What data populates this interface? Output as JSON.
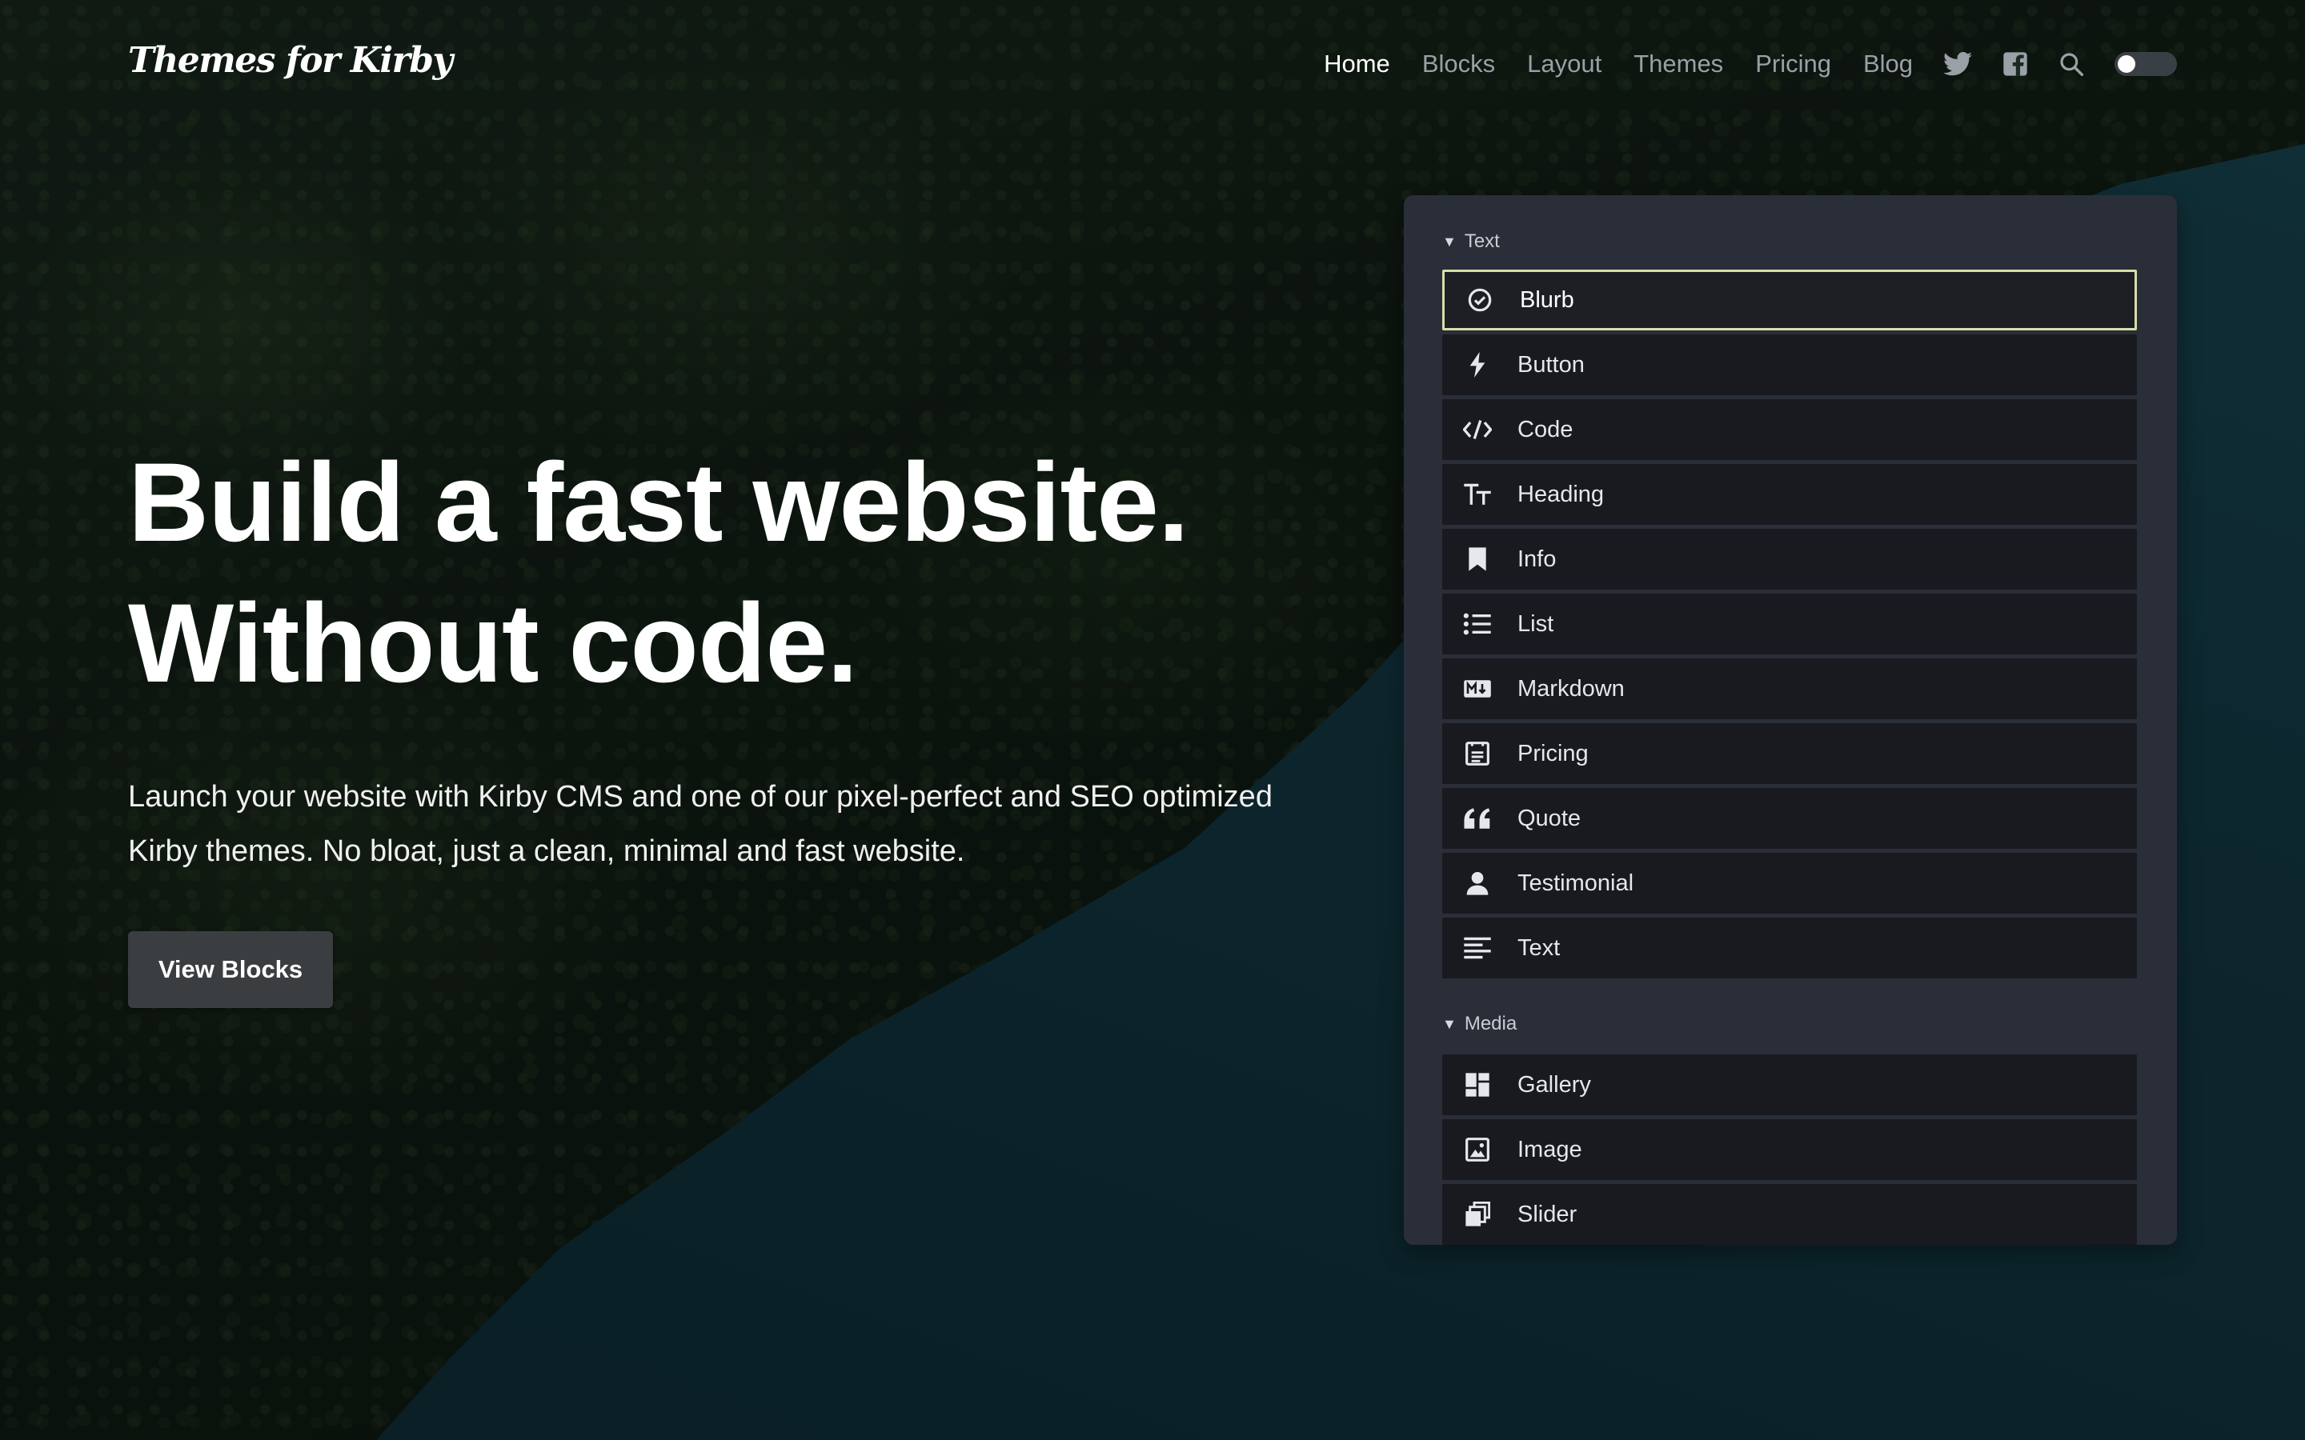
{
  "header": {
    "logo": "Themes for Kirby",
    "nav": [
      "Home",
      "Blocks",
      "Layout",
      "Themes",
      "Pricing",
      "Blog"
    ],
    "active_nav": "Home",
    "icons": [
      "twitter-icon",
      "facebook-icon",
      "search-icon"
    ],
    "theme_toggle": "dark-mode-toggle"
  },
  "hero": {
    "title_line1": "Build a fast website.",
    "title_line2": "Without code.",
    "description": "Launch your website with Kirby CMS and one of our pixel-perfect and SEO optimized Kirby themes. No bloat, just a clean, minimal and fast website.",
    "cta_label": "View Blocks"
  },
  "panel": {
    "groups": [
      {
        "label": "Text",
        "items": [
          {
            "label": "Blurb",
            "icon": "check-circle-icon",
            "selected": true
          },
          {
            "label": "Button",
            "icon": "bolt-icon"
          },
          {
            "label": "Code",
            "icon": "code-icon"
          },
          {
            "label": "Heading",
            "icon": "heading-icon"
          },
          {
            "label": "Info",
            "icon": "bookmark-icon"
          },
          {
            "label": "List",
            "icon": "list-icon"
          },
          {
            "label": "Markdown",
            "icon": "markdown-icon"
          },
          {
            "label": "Pricing",
            "icon": "pricing-icon"
          },
          {
            "label": "Quote",
            "icon": "quote-icon"
          },
          {
            "label": "Testimonial",
            "icon": "user-icon"
          },
          {
            "label": "Text",
            "icon": "text-icon"
          }
        ]
      },
      {
        "label": "Media",
        "items": [
          {
            "label": "Gallery",
            "icon": "gallery-icon"
          },
          {
            "label": "Image",
            "icon": "image-icon"
          },
          {
            "label": "Slider",
            "icon": "slider-icon"
          }
        ]
      }
    ]
  },
  "colors": {
    "selected_border": "#d7dfa8",
    "panel_bg": "#2a2e38",
    "item_bg": "#181a20",
    "nav_inactive": "#9aa0a6"
  }
}
